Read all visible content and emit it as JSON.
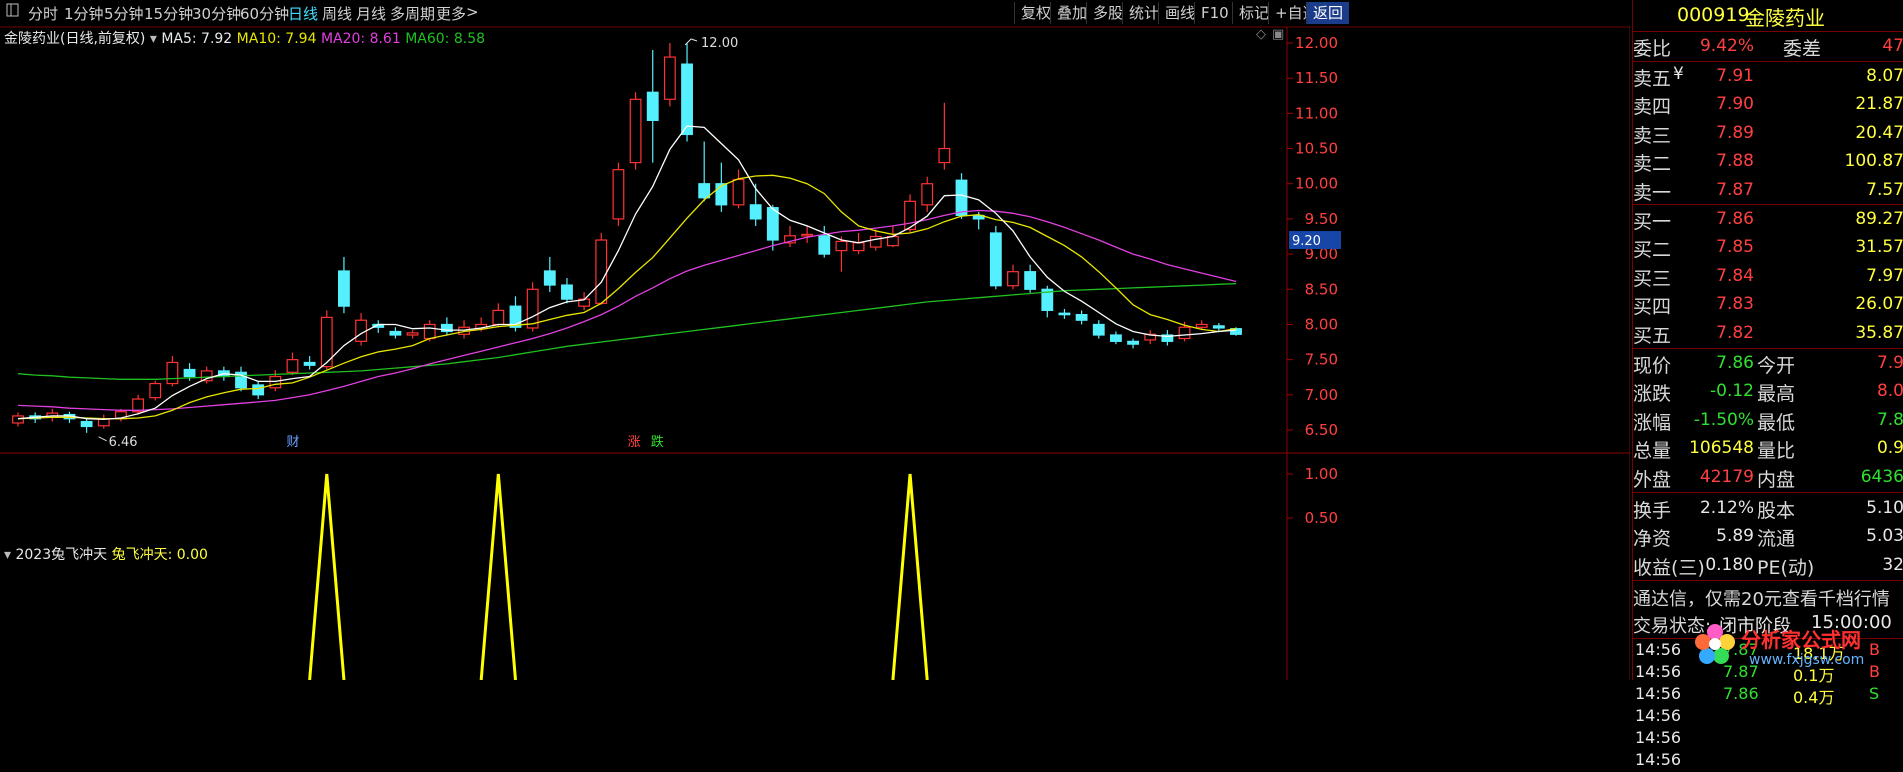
{
  "toolbar": {
    "left_icon": "window-icon",
    "periods": [
      "分时",
      "1分钟",
      "5分钟",
      "15分钟",
      "30分钟",
      "60分钟",
      "日线",
      "周线",
      "月线",
      "多周期",
      "更多"
    ],
    "active_period": "日线",
    "right_buttons": [
      "复权",
      "叠加",
      "多股",
      "统计",
      "画线",
      "F10",
      "标记",
      "+自选",
      "返回"
    ]
  },
  "chart_header": {
    "title": "金陵药业(日线,前复权)",
    "ma5": "MA5: 7.92",
    "ma10": "MA10: 7.94",
    "ma20": "MA20: 8.61",
    "ma60": "MA60: 8.58"
  },
  "price_axis": [
    "12.00",
    "11.50",
    "11.00",
    "10.50",
    "10.00",
    "9.50",
    "9.00",
    "8.50",
    "8.00",
    "7.50",
    "7.00",
    "6.50"
  ],
  "indicator_axis": [
    "1.00",
    "0.50"
  ],
  "labels": {
    "high_marker": "12.00",
    "low_marker": "6.46",
    "cursor_price": "9.20",
    "event_cai": "财",
    "event_zhang": "涨",
    "event_die": "跌"
  },
  "indicator": {
    "name": "2023兔飞冲天",
    "value_label": "兔飞冲天: 0.00"
  },
  "colors": {
    "up": "#ff3333",
    "down": "#55f0ff",
    "ma5": "#ffffff",
    "ma10": "#e6e600",
    "ma20": "#e040e0",
    "ma60": "#20c020",
    "signal": "#ffff00"
  },
  "chart_data": {
    "type": "candlestick",
    "ylim": [
      6.3,
      12.3
    ],
    "candles": [
      [
        6.6,
        6.7,
        6.75,
        6.55
      ],
      [
        6.7,
        6.66,
        6.75,
        6.6
      ],
      [
        6.68,
        6.74,
        6.8,
        6.62
      ],
      [
        6.72,
        6.66,
        6.76,
        6.6
      ],
      [
        6.62,
        6.55,
        6.66,
        6.46
      ],
      [
        6.56,
        6.66,
        6.72,
        6.52
      ],
      [
        6.66,
        6.76,
        6.8,
        6.62
      ],
      [
        6.76,
        6.94,
        7.0,
        6.72
      ],
      [
        6.96,
        7.16,
        7.2,
        6.92
      ],
      [
        7.16,
        7.46,
        7.55,
        7.12
      ],
      [
        7.36,
        7.26,
        7.45,
        7.2
      ],
      [
        7.2,
        7.34,
        7.4,
        7.16
      ],
      [
        7.34,
        7.26,
        7.4,
        7.2
      ],
      [
        7.32,
        7.1,
        7.4,
        7.05
      ],
      [
        7.14,
        7.0,
        7.2,
        6.94
      ],
      [
        7.1,
        7.26,
        7.35,
        7.05
      ],
      [
        7.32,
        7.5,
        7.6,
        7.28
      ],
      [
        7.46,
        7.42,
        7.55,
        7.36
      ],
      [
        7.4,
        8.1,
        8.2,
        7.36
      ],
      [
        8.76,
        8.26,
        8.96,
        8.16
      ],
      [
        7.76,
        8.06,
        8.16,
        7.7
      ],
      [
        8.0,
        7.96,
        8.06,
        7.88
      ],
      [
        7.9,
        7.85,
        7.96,
        7.8
      ],
      [
        7.85,
        7.88,
        7.92,
        7.8
      ],
      [
        7.8,
        8.0,
        8.06,
        7.76
      ],
      [
        8.0,
        7.9,
        8.1,
        7.84
      ],
      [
        7.86,
        7.96,
        8.06,
        7.8
      ],
      [
        7.94,
        8.0,
        8.1,
        7.9
      ],
      [
        8.0,
        8.2,
        8.3,
        7.96
      ],
      [
        8.26,
        7.96,
        8.4,
        7.9
      ],
      [
        7.95,
        8.5,
        8.6,
        7.9
      ],
      [
        8.76,
        8.56,
        8.96,
        8.46
      ],
      [
        8.56,
        8.36,
        8.66,
        8.3
      ],
      [
        8.26,
        8.36,
        8.46,
        8.2
      ],
      [
        8.3,
        9.2,
        9.3,
        8.28
      ],
      [
        9.5,
        10.2,
        10.3,
        9.4
      ],
      [
        10.3,
        11.2,
        11.3,
        10.2
      ],
      [
        11.3,
        10.9,
        11.9,
        10.3
      ],
      [
        11.2,
        11.8,
        12.0,
        11.1
      ],
      [
        11.7,
        10.7,
        12.0,
        10.6
      ],
      [
        10.0,
        9.8,
        10.6,
        9.75
      ],
      [
        10.0,
        9.7,
        10.3,
        9.6
      ],
      [
        9.7,
        10.06,
        10.2,
        9.65
      ],
      [
        9.7,
        9.5,
        10.0,
        9.4
      ],
      [
        9.66,
        9.2,
        9.7,
        9.05
      ],
      [
        9.16,
        9.26,
        9.4,
        9.1
      ],
      [
        9.26,
        9.28,
        9.4,
        9.16
      ],
      [
        9.26,
        9.0,
        9.4,
        8.95
      ],
      [
        9.05,
        9.18,
        9.25,
        8.75
      ],
      [
        9.05,
        9.16,
        9.3,
        9.0
      ],
      [
        9.1,
        9.25,
        9.35,
        9.05
      ],
      [
        9.12,
        9.25,
        9.4,
        9.1
      ],
      [
        9.35,
        9.75,
        9.85,
        9.3
      ],
      [
        9.7,
        10.0,
        10.1,
        9.6
      ],
      [
        10.3,
        10.5,
        11.15,
        10.2
      ],
      [
        10.05,
        9.55,
        10.15,
        9.5
      ],
      [
        9.55,
        9.5,
        9.6,
        9.35
      ],
      [
        9.3,
        8.55,
        9.4,
        8.5
      ],
      [
        8.55,
        8.75,
        8.85,
        8.5
      ],
      [
        8.75,
        8.5,
        8.85,
        8.45
      ],
      [
        8.5,
        8.2,
        8.55,
        8.1
      ],
      [
        8.16,
        8.14,
        8.22,
        8.08
      ],
      [
        8.14,
        8.06,
        8.2,
        8.0
      ],
      [
        8.0,
        7.85,
        8.06,
        7.8
      ],
      [
        7.85,
        7.76,
        7.9,
        7.72
      ],
      [
        7.76,
        7.72,
        7.8,
        7.66
      ],
      [
        7.78,
        7.86,
        7.92,
        7.72
      ],
      [
        7.85,
        7.76,
        7.92,
        7.7
      ],
      [
        7.8,
        7.96,
        8.04,
        7.76
      ],
      [
        7.96,
        8.0,
        8.06,
        7.92
      ],
      [
        7.98,
        7.95,
        8.02,
        7.9
      ],
      [
        7.94,
        7.86,
        7.96,
        7.84
      ]
    ],
    "ma5": [
      6.66,
      6.68,
      6.7,
      6.7,
      6.66,
      6.65,
      6.67,
      6.73,
      6.81,
      6.99,
      7.12,
      7.23,
      7.3,
      7.28,
      7.19,
      7.19,
      7.23,
      7.26,
      7.46,
      7.7,
      7.87,
      8.0,
      8.0,
      7.94,
      7.95,
      7.92,
      7.92,
      7.95,
      8.0,
      8.0,
      8.11,
      8.24,
      8.32,
      8.35,
      8.6,
      9.05,
      9.57,
      9.96,
      10.49,
      10.82,
      10.8,
      10.57,
      10.34,
      9.93,
      9.64,
      9.48,
      9.4,
      9.3,
      9.2,
      9.16,
      9.21,
      9.25,
      9.38,
      9.54,
      9.83,
      9.84,
      9.77,
      9.58,
      9.33,
      8.96,
      8.67,
      8.47,
      8.33,
      8.17,
      8.01,
      7.9,
      7.85,
      7.83,
      7.85,
      7.87,
      7.9,
      7.92
    ],
    "ma10": [
      6.66,
      6.67,
      6.68,
      6.68,
      6.67,
      6.66,
      6.66,
      6.67,
      6.7,
      6.78,
      6.89,
      6.97,
      7.03,
      7.08,
      7.09,
      7.15,
      7.17,
      7.25,
      7.35,
      7.45,
      7.54,
      7.61,
      7.65,
      7.7,
      7.8,
      7.85,
      7.9,
      7.93,
      7.97,
      7.99,
      8.01,
      8.07,
      8.13,
      8.17,
      8.3,
      8.51,
      8.74,
      8.95,
      9.23,
      9.51,
      9.77,
      9.97,
      10.07,
      10.11,
      10.12,
      10.08,
      10.0,
      9.86,
      9.6,
      9.4,
      9.33,
      9.28,
      9.3,
      9.36,
      9.46,
      9.54,
      9.56,
      9.49,
      9.45,
      9.38,
      9.25,
      9.12,
      8.96,
      8.75,
      8.52,
      8.28,
      8.14,
      8.07,
      7.99,
      7.93,
      7.9,
      7.94
    ],
    "ma20": [
      6.85,
      6.84,
      6.83,
      6.81,
      6.8,
      6.79,
      6.78,
      6.78,
      6.79,
      6.8,
      6.82,
      6.84,
      6.86,
      6.88,
      6.9,
      6.92,
      6.96,
      7.0,
      7.06,
      7.12,
      7.19,
      7.26,
      7.31,
      7.37,
      7.44,
      7.5,
      7.56,
      7.62,
      7.68,
      7.74,
      7.8,
      7.87,
      7.95,
      8.04,
      8.14,
      8.26,
      8.4,
      8.52,
      8.65,
      8.76,
      8.84,
      8.91,
      8.98,
      9.05,
      9.12,
      9.18,
      9.24,
      9.28,
      9.32,
      9.34,
      9.37,
      9.4,
      9.44,
      9.49,
      9.55,
      9.6,
      9.62,
      9.61,
      9.58,
      9.53,
      9.46,
      9.38,
      9.29,
      9.2,
      9.1,
      9.0,
      8.93,
      8.85,
      8.79,
      8.73,
      8.67,
      8.61
    ],
    "ma60": [
      7.3,
      7.28,
      7.27,
      7.25,
      7.24,
      7.23,
      7.22,
      7.22,
      7.22,
      7.23,
      7.24,
      7.25,
      7.26,
      7.27,
      7.28,
      7.29,
      7.3,
      7.31,
      7.32,
      7.33,
      7.34,
      7.36,
      7.38,
      7.4,
      7.42,
      7.44,
      7.47,
      7.5,
      7.53,
      7.57,
      7.61,
      7.65,
      7.69,
      7.72,
      7.75,
      7.78,
      7.81,
      7.84,
      7.87,
      7.9,
      7.93,
      7.96,
      7.99,
      8.02,
      8.05,
      8.08,
      8.11,
      8.14,
      8.17,
      8.2,
      8.23,
      8.26,
      8.29,
      8.32,
      8.34,
      8.36,
      8.38,
      8.4,
      8.42,
      8.44,
      8.46,
      8.48,
      8.49,
      8.5,
      8.51,
      8.52,
      8.53,
      8.54,
      8.55,
      8.56,
      8.57,
      8.58
    ],
    "signals_at": [
      18,
      28,
      52
    ]
  },
  "side": {
    "code": "000919",
    "name": "金陵药业",
    "weibi_label": "委比",
    "weibi_value": "9.42%",
    "weicha_label": "委差",
    "weicha_value": "47",
    "asks": [
      {
        "label": "卖五",
        "mark": "¥",
        "price": "7.91",
        "vol": "8.07"
      },
      {
        "label": "卖四",
        "mark": "",
        "price": "7.90",
        "vol": "21.87"
      },
      {
        "label": "卖三",
        "mark": "",
        "price": "7.89",
        "vol": "20.47"
      },
      {
        "label": "卖二",
        "mark": "",
        "price": "7.88",
        "vol": "100.87"
      },
      {
        "label": "卖一",
        "mark": "",
        "price": "7.87",
        "vol": "7.57"
      }
    ],
    "bids": [
      {
        "label": "买一",
        "price": "7.86",
        "vol": "89.27"
      },
      {
        "label": "买二",
        "price": "7.85",
        "vol": "31.57"
      },
      {
        "label": "买三",
        "price": "7.84",
        "vol": "7.97"
      },
      {
        "label": "买四",
        "price": "7.83",
        "vol": "26.07"
      },
      {
        "label": "买五",
        "price": "7.82",
        "vol": "35.87"
      }
    ],
    "stats": [
      {
        "l1": "现价",
        "v1": "7.86",
        "c1": "green",
        "l2": "今开",
        "v2": "7.9",
        "c2": "red"
      },
      {
        "l1": "涨跌",
        "v1": "-0.12",
        "c1": "green",
        "l2": "最高",
        "v2": "8.0",
        "c2": "red"
      },
      {
        "l1": "涨幅",
        "v1": "-1.50%",
        "c1": "green",
        "l2": "最低",
        "v2": "7.8",
        "c2": "green"
      },
      {
        "l1": "总量",
        "v1": "106548",
        "c1": "yellow",
        "l2": "量比",
        "v2": "0.9",
        "c2": "yellow"
      },
      {
        "l1": "外盘",
        "v1": "42179",
        "c1": "red",
        "l2": "内盘",
        "v2": "6436",
        "c2": "green"
      }
    ],
    "stats2": [
      {
        "l1": "换手",
        "v1": "2.12%",
        "l2": "股本",
        "v2": "5.10"
      },
      {
        "l1": "净资",
        "v1": "5.89",
        "l2": "流通",
        "v2": "5.03"
      },
      {
        "l1": "收益(三)",
        "v1": "0.180",
        "l2": "PE(动)",
        "v2": "32"
      }
    ],
    "notice": "通达信，仅需20元查看千档行情",
    "trade_status_label": "交易状态:",
    "trade_status_value": "闭市阶段",
    "trade_status_time": "15:00:00",
    "ticks": [
      {
        "time": "14:56",
        "price": "7.87",
        "vol": "18.1万",
        "bs": "B"
      },
      {
        "time": "14:56",
        "price": "7.87",
        "vol": "0.1万",
        "bs": "B"
      },
      {
        "time": "14:56",
        "price": "7.86",
        "vol": "0.4万",
        "bs": "S"
      },
      {
        "time": "14:56",
        "price": "",
        "vol": "",
        "bs": ""
      },
      {
        "time": "14:56",
        "price": "",
        "vol": "",
        "bs": ""
      },
      {
        "time": "14:56",
        "price": "",
        "vol": "",
        "bs": ""
      }
    ],
    "watermark_cn": "分析家公式网",
    "watermark_url": "www.fxjgsw.com"
  }
}
